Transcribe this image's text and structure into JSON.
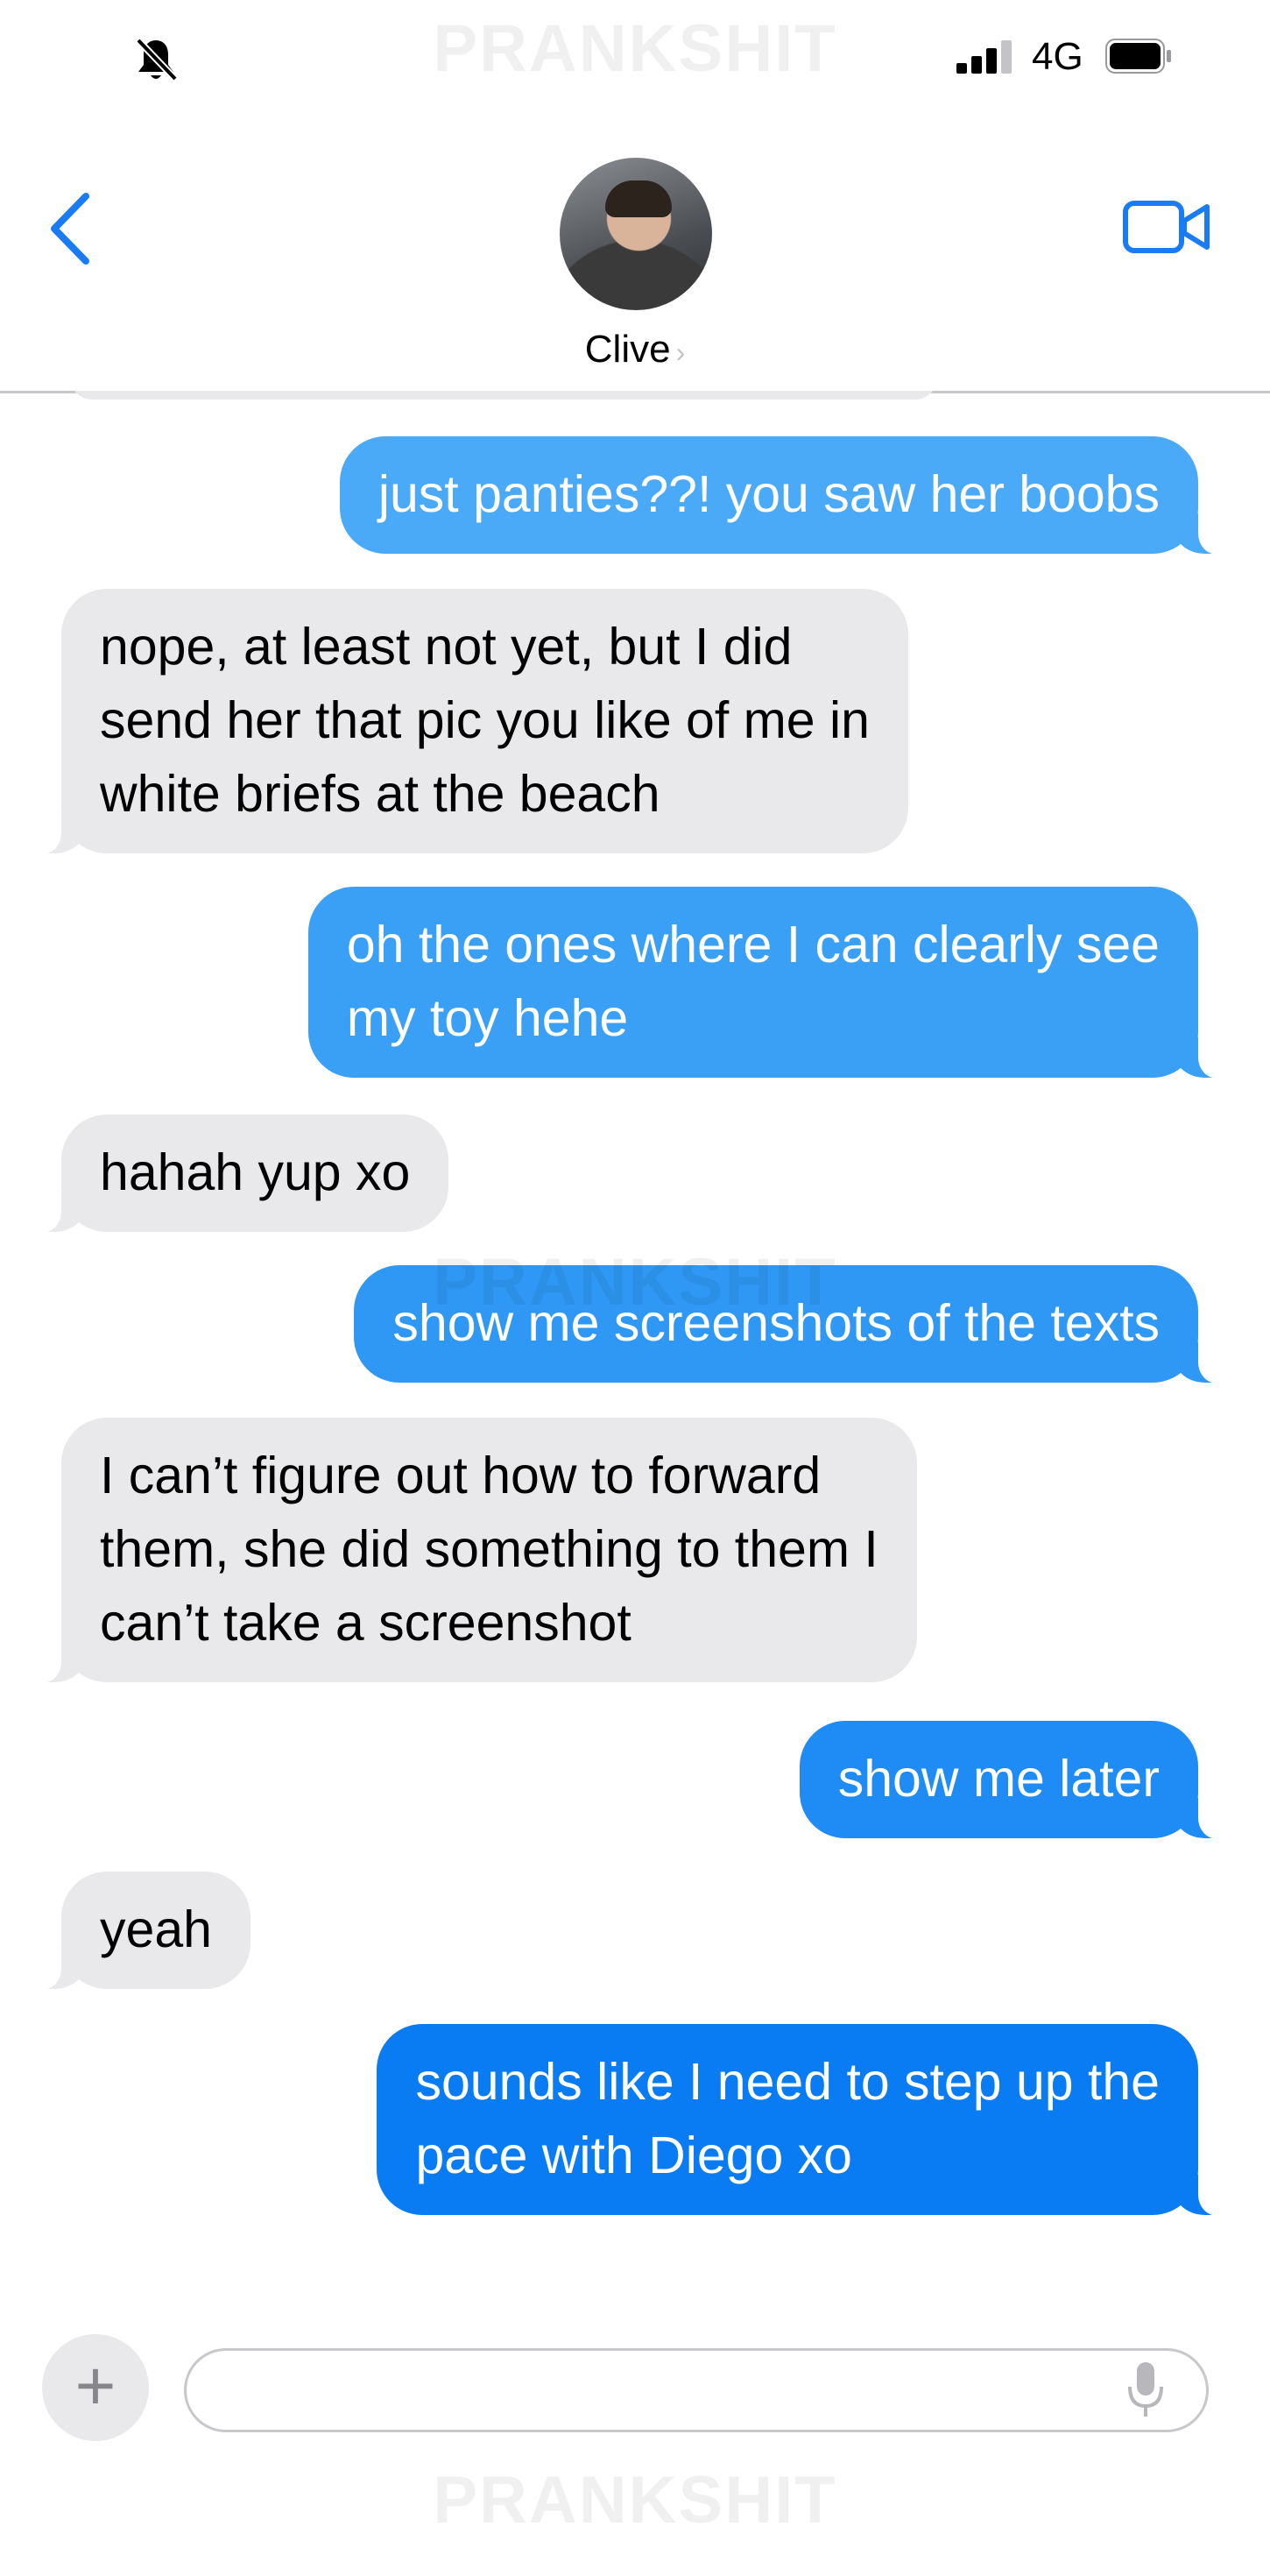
{
  "status_bar": {
    "network": "4G",
    "signal_bars": 3,
    "icons": [
      "bell-slash-icon",
      "signal-icon",
      "battery-icon"
    ]
  },
  "watermark": "PRANKSHIT",
  "header": {
    "contact_name": "Clive",
    "chevron": "›",
    "icons": [
      "back-chevron-icon",
      "video-camera-icon",
      "avatar"
    ]
  },
  "messages": [
    {
      "sender": "me",
      "text": "just panties??! you saw her boobs"
    },
    {
      "sender": "them",
      "text": "nope, at least not yet, but I did\nsend her that pic you like of me in\nwhite briefs at the beach"
    },
    {
      "sender": "me",
      "text": "oh the ones where I can clearly see\nmy toy hehe"
    },
    {
      "sender": "them",
      "text": "hahah yup xo"
    },
    {
      "sender": "me",
      "text": "show me screenshots of the texts"
    },
    {
      "sender": "them",
      "text": "I can’t figure out how to forward\nthem, she did something to them I\ncan’t take a screenshot"
    },
    {
      "sender": "me",
      "text": "show me later"
    },
    {
      "sender": "them",
      "text": "yeah"
    },
    {
      "sender": "me",
      "text": "sounds like I need to step up the\npace with Diego xo"
    }
  ],
  "compose": {
    "plus_label": "+",
    "placeholder": "",
    "icons": [
      "plus-icon",
      "microphone-icon"
    ]
  },
  "colors": {
    "accent": "#1a7cf5",
    "incoming_bubble": "#e9e9eb",
    "outgoing_gradient": [
      "#44a8f7",
      "#0a7af3"
    ]
  }
}
